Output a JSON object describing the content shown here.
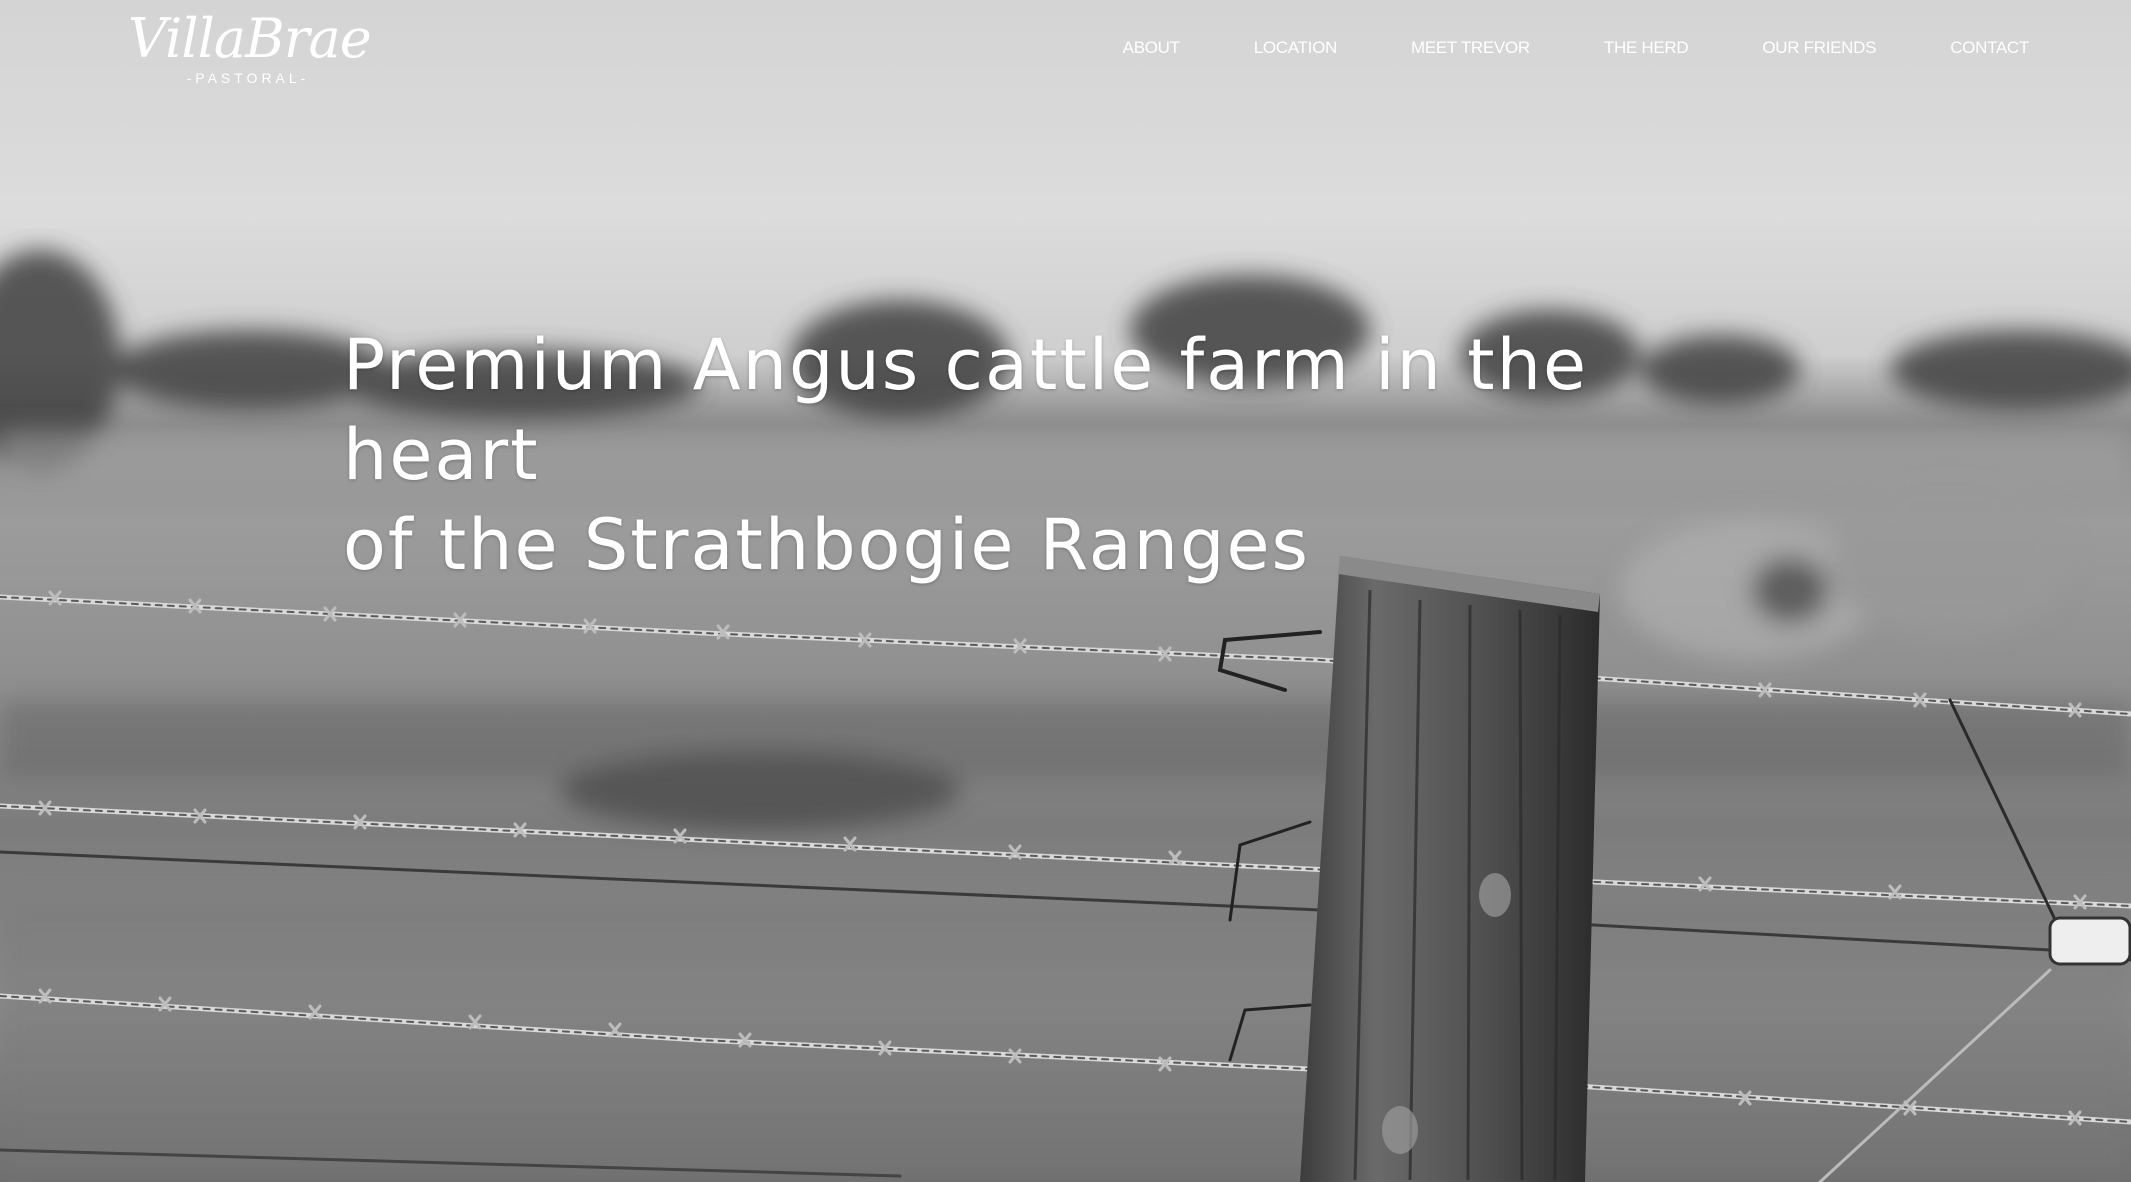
{
  "brand": {
    "name": "VillaBrae",
    "tagline": "-PASTORAL-"
  },
  "nav": {
    "items": [
      {
        "label": "ABOUT"
      },
      {
        "label": "LOCATION"
      },
      {
        "label": "MEET TREVOR"
      },
      {
        "label": "THE HERD"
      },
      {
        "label": "OUR FRIENDS"
      },
      {
        "label": "CONTACT"
      }
    ]
  },
  "hero": {
    "headline_line1": "Premium Angus cattle farm in the heart",
    "headline_line2": "of the Strathbogie Ranges",
    "image_style": "black-and-white photo of barbed wire fence and wooden post in a field"
  },
  "colors": {
    "text": "#ffffff",
    "sky": "#d9d9d9",
    "field": "#7a7a7a"
  }
}
